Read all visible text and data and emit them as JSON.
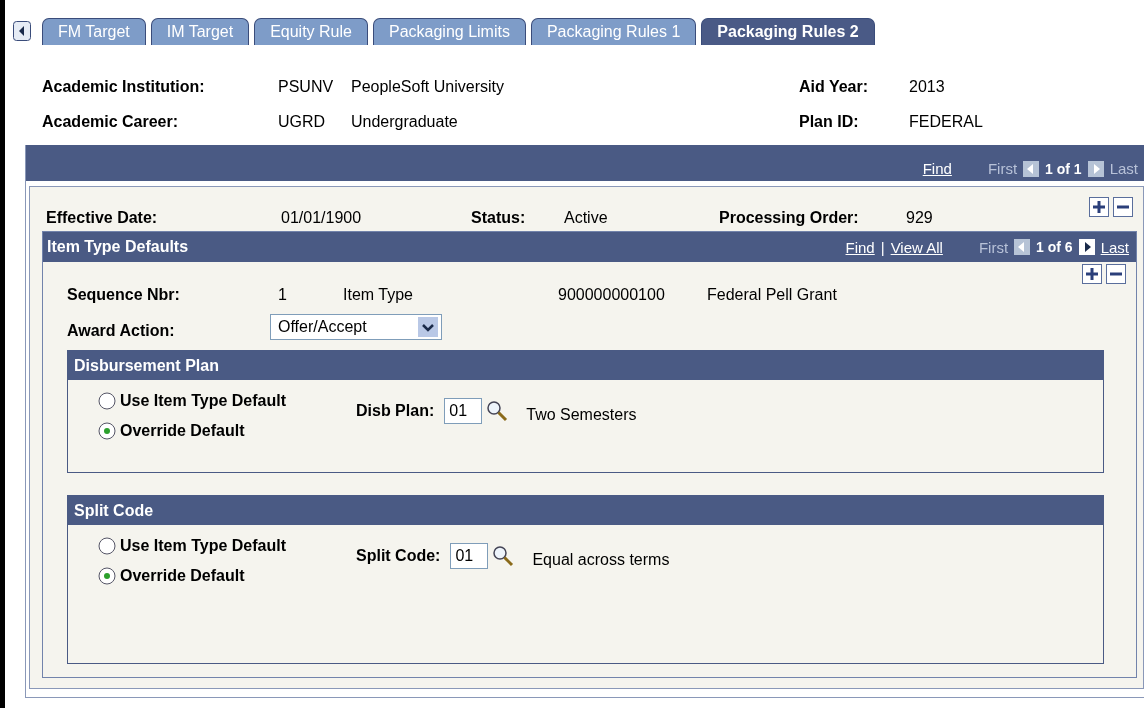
{
  "tabs": [
    {
      "label": "FM Target",
      "selected": false
    },
    {
      "label": "IM Target",
      "selected": false
    },
    {
      "label": "Equity Rule",
      "selected": false
    },
    {
      "label": "Packaging Limits",
      "selected": false
    },
    {
      "label": "Packaging Rules 1",
      "selected": false
    },
    {
      "label": "Packaging Rules 2",
      "selected": true
    }
  ],
  "header": {
    "rows": [
      {
        "label": "Academic Institution:",
        "code": "PSUNV",
        "name": "PeopleSoft University",
        "right_label": "Aid Year:",
        "right_value": "2013"
      },
      {
        "label": "Academic Career:",
        "code": "UGRD",
        "name": "Undergraduate",
        "right_label": "Plan ID:",
        "right_value": "FEDERAL"
      }
    ]
  },
  "effective_nav": {
    "links": [
      "Find"
    ],
    "first": {
      "label": "First",
      "disabled": true
    },
    "prev_disabled": true,
    "count": "1 of 1",
    "next_disabled": true,
    "last": {
      "label": "Last",
      "disabled": true
    }
  },
  "effective": {
    "date_label": "Effective Date:",
    "date": "01/01/1900",
    "status_label": "Status:",
    "status": "Active",
    "order_label": "Processing Order:",
    "order": "929"
  },
  "item_type_defaults": {
    "title": "Item Type Defaults",
    "nav": {
      "links": [
        "Find",
        "View All"
      ],
      "separator": "|",
      "first": {
        "label": "First",
        "disabled": true
      },
      "prev_disabled": true,
      "count": "1 of 6",
      "next_disabled": false,
      "last": {
        "label": "Last",
        "disabled": false
      }
    },
    "sequence_label": "Sequence Nbr:",
    "sequence": "1",
    "item_type_label": "Item Type",
    "item_type": "900000000100",
    "item_type_name": "Federal Pell Grant",
    "award_action_label": "Award Action:",
    "award_action": "Offer/Accept",
    "sections": [
      {
        "title": "Disbursement Plan",
        "options": [
          {
            "label": "Use Item Type Default",
            "selected": false
          },
          {
            "label": "Override Default",
            "selected": true
          }
        ],
        "field_label": "Disb Plan:",
        "field_value": "01",
        "description": "Two Semesters"
      },
      {
        "title": "Split Code",
        "options": [
          {
            "label": "Use Item Type Default",
            "selected": false
          },
          {
            "label": "Override Default",
            "selected": true
          }
        ],
        "field_label": "Split Code:",
        "field_value": "01",
        "description": "Equal across terms"
      }
    ]
  }
}
